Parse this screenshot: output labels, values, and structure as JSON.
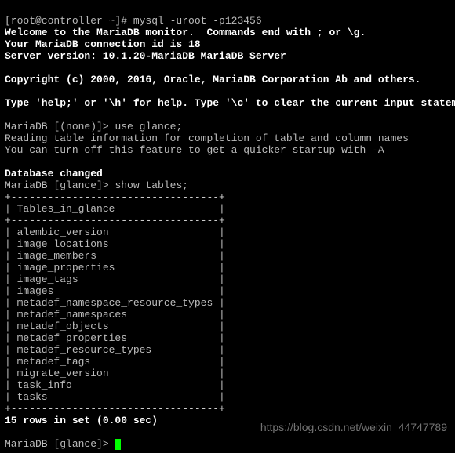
{
  "prompt_shell": "[root@controller ~]# ",
  "cmd_mysql": "mysql -uroot -p123456",
  "welcome1": "Welcome to the MariaDB monitor.  Commands end with ; or \\g.",
  "welcome2": "Your MariaDB connection id is 18",
  "welcome3": "Server version: 10.1.20-MariaDB MariaDB Server",
  "copyright": "Copyright (c) 2000, 2016, Oracle, MariaDB Corporation Ab and others.",
  "help_line": "Type 'help;' or '\\h' for help. Type '\\c' to clear the current input statement.",
  "prompt_none": "MariaDB [(none)]> ",
  "cmd_use": "use glance;",
  "reading1": "Reading table information for completion of table and column names",
  "reading2": "You can turn off this feature to get a quicker startup with -A",
  "db_changed": "Database changed",
  "prompt_glance": "MariaDB [glance]> ",
  "cmd_show": "show tables;",
  "table_border": "+----------------------------------+",
  "header_label": "| Tables_in_glance                 |",
  "rows": [
    "| alembic_version                  |",
    "| image_locations                  |",
    "| image_members                    |",
    "| image_properties                 |",
    "| image_tags                       |",
    "| images                           |",
    "| metadef_namespace_resource_types |",
    "| metadef_namespaces               |",
    "| metadef_objects                  |",
    "| metadef_properties               |",
    "| metadef_resource_types           |",
    "| metadef_tags                     |",
    "| migrate_version                  |",
    "| task_info                        |",
    "| tasks                            |"
  ],
  "result_summary": "15 rows in set (0.00 sec)",
  "watermark": "https://blog.csdn.net/weixin_44747789"
}
